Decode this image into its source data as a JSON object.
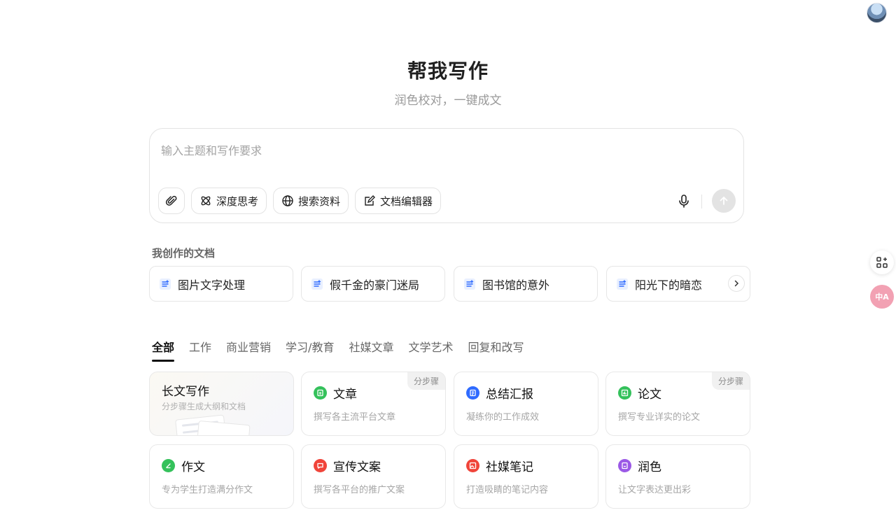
{
  "header": {
    "title": "帮我写作",
    "subtitle": "润色校对，一键成文"
  },
  "input": {
    "placeholder": "输入主题和写作要求",
    "tools": [
      {
        "label": "深度思考",
        "icon": "atom-icon"
      },
      {
        "label": "搜索资料",
        "icon": "globe-icon"
      },
      {
        "label": "文档编辑器",
        "icon": "edit-doc-icon"
      }
    ]
  },
  "my_docs": {
    "label": "我创作的文档",
    "items": [
      "图片文字处理",
      "假千金的豪门迷局",
      "图书馆的意外",
      "阳光下的暗恋"
    ]
  },
  "tabs": [
    "全部",
    "工作",
    "商业营销",
    "学习/教育",
    "社媒文章",
    "文学艺术",
    "回复和改写"
  ],
  "tiles": [
    {
      "title": "长文写作",
      "desc": "分步骤生成大纲和文档"
    },
    {
      "title": "文章",
      "desc": "撰写各主流平台文章",
      "badge": "分步骤",
      "color": "#34c15b"
    },
    {
      "title": "总结汇报",
      "desc": "凝练你的工作成效",
      "color": "#2f6bff"
    },
    {
      "title": "论文",
      "desc": "撰写专业详实的论文",
      "badge": "分步骤",
      "color": "#34c15b"
    },
    {
      "title": "作文",
      "desc": "专为学生打造满分作文",
      "color": "#34c15b"
    },
    {
      "title": "宣传文案",
      "desc": "撰写各平台的推广文案",
      "color": "#f0443a"
    },
    {
      "title": "社媒笔记",
      "desc": "打造吸睛的笔记内容",
      "color": "#f0443a"
    },
    {
      "title": "润色",
      "desc": "让文字表达更出彩",
      "color": "#9b59e6"
    }
  ],
  "side": {
    "translate_label": "中A"
  }
}
